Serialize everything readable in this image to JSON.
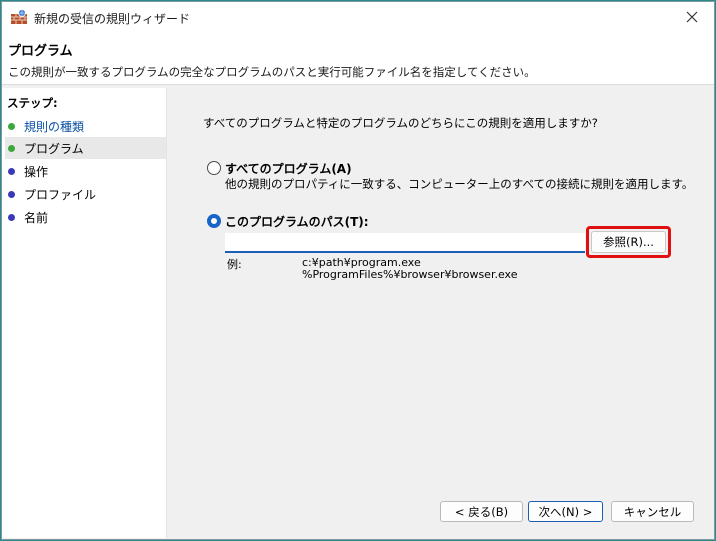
{
  "window": {
    "title": "新規の受信の規則ウィザード"
  },
  "header": {
    "title": "プログラム",
    "description": "この規則が一致するプログラムの完全なプログラムのパスと実行可能ファイル名を指定してください。"
  },
  "sidebar": {
    "title": "ステップ:",
    "items": [
      {
        "label": "規則の種類",
        "dot_color": "#3aa83a"
      },
      {
        "label": "プログラム",
        "dot_color": "#3aa83a"
      },
      {
        "label": "操作",
        "dot_color": "#3a3ab8"
      },
      {
        "label": "プロファイル",
        "dot_color": "#3a3ab8"
      },
      {
        "label": "名前",
        "dot_color": "#3a3ab8"
      }
    ]
  },
  "main": {
    "question": "すべてのプログラムと特定のプログラムのどちらにこの規則を適用しますか?",
    "option_all": {
      "label": "すべてのプログラム(A)",
      "description": "他の規則のプロパティに一致する、コンピューター上のすべての接続に規則を適用します。"
    },
    "option_path": {
      "label": "このプログラムのパス(T):"
    },
    "path_input": {
      "value": ""
    },
    "browse_label": "参照(R)...",
    "example_label": "例:",
    "example_lines": [
      "c:¥path¥program.exe",
      "%ProgramFiles%¥browser¥browser.exe"
    ]
  },
  "buttons": {
    "back": "< 戻る(B)",
    "next": "次へ(N) >",
    "cancel": "キャンセル"
  }
}
